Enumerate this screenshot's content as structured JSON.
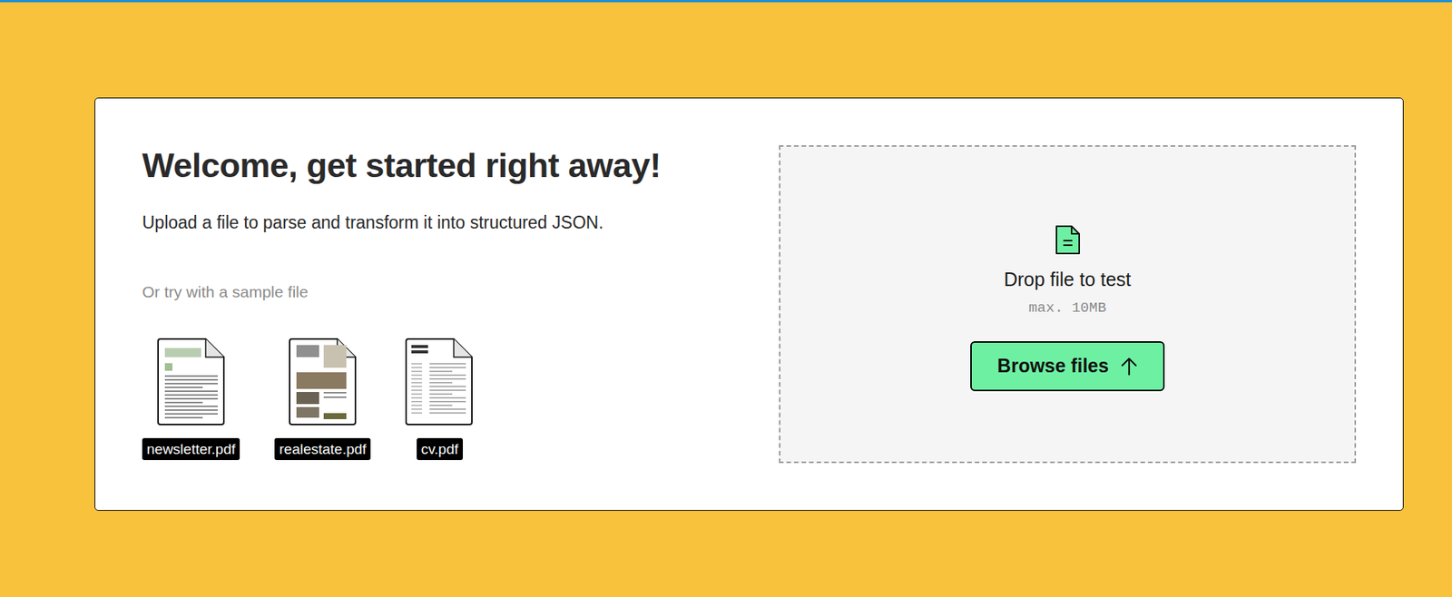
{
  "page": {
    "title": "Welcome, get started right away!",
    "subtitle": "Upload a file to parse and transform it into structured JSON.",
    "samples_label": "Or try with a sample file"
  },
  "samples": [
    {
      "name": "newsletter.pdf"
    },
    {
      "name": "realestate.pdf"
    },
    {
      "name": "cv.pdf"
    }
  ],
  "dropzone": {
    "title": "Drop file to test",
    "limit": "max. 10MB",
    "button": "Browse files"
  }
}
